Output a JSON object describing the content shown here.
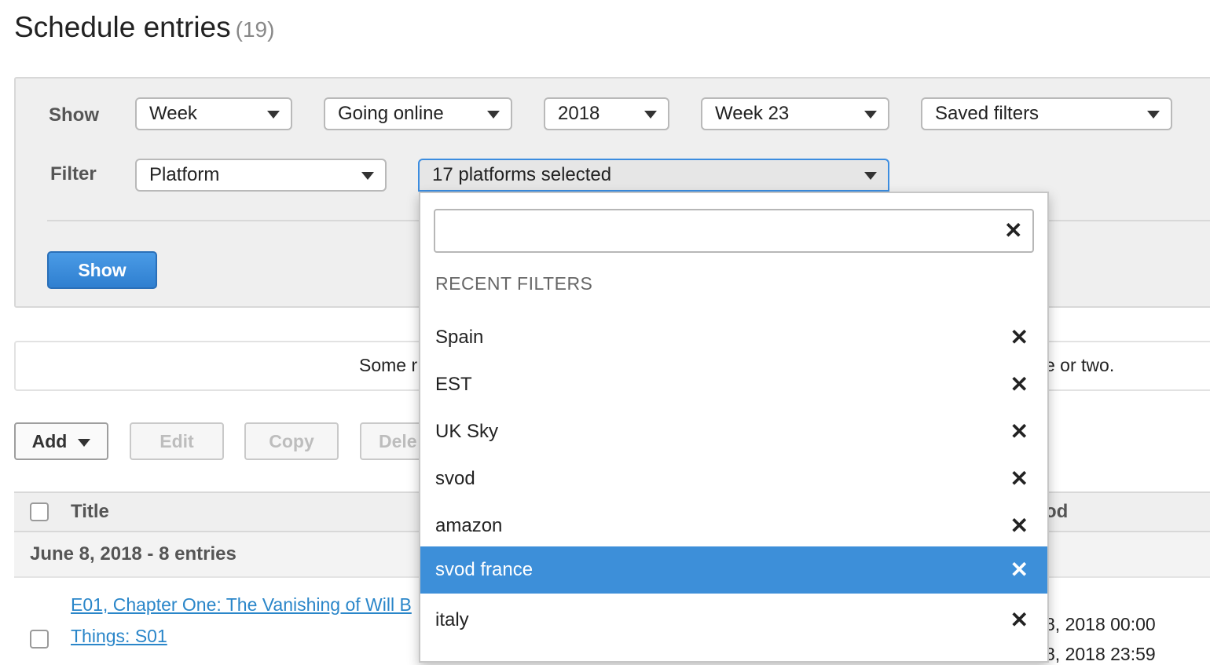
{
  "header": {
    "title": "Schedule entries",
    "count": "(19)"
  },
  "filters": {
    "show_label": "Show",
    "filter_label": "Filter",
    "period": "Week",
    "status": "Going online",
    "year": "2018",
    "week": "Week 23",
    "saved_filters": "Saved filters",
    "filter_type": "Platform",
    "platforms_selected": "17 platforms selected",
    "show_button": "Show"
  },
  "notice": {
    "text_left": "Some r",
    "text_right": "e or two."
  },
  "toolbar": {
    "add": "Add",
    "edit": "Edit",
    "copy": "Copy",
    "delete": "Dele"
  },
  "table": {
    "col_title": "Title",
    "col_period": "od",
    "group_label": "June 8, 2018 - 8 entries",
    "row1": {
      "title_line1": "E01, Chapter One: The Vanishing of Will B",
      "title_line2": "Things: S01",
      "date1": "8, 2018 00:00",
      "date2": "8, 2018 23:59"
    }
  },
  "dropdown": {
    "search_value": "",
    "clear_icon": "close-icon",
    "heading": "RECENT FILTERS",
    "items": [
      {
        "label": "Spain"
      },
      {
        "label": "EST"
      },
      {
        "label": "UK Sky"
      },
      {
        "label": "svod"
      },
      {
        "label": "amazon"
      },
      {
        "label": "svod france",
        "highlighted": true
      },
      {
        "label": "italy"
      }
    ]
  },
  "colors": {
    "accent": "#3d8fd9",
    "link": "#2a86c9",
    "primary_button": "#2f7fd0"
  }
}
